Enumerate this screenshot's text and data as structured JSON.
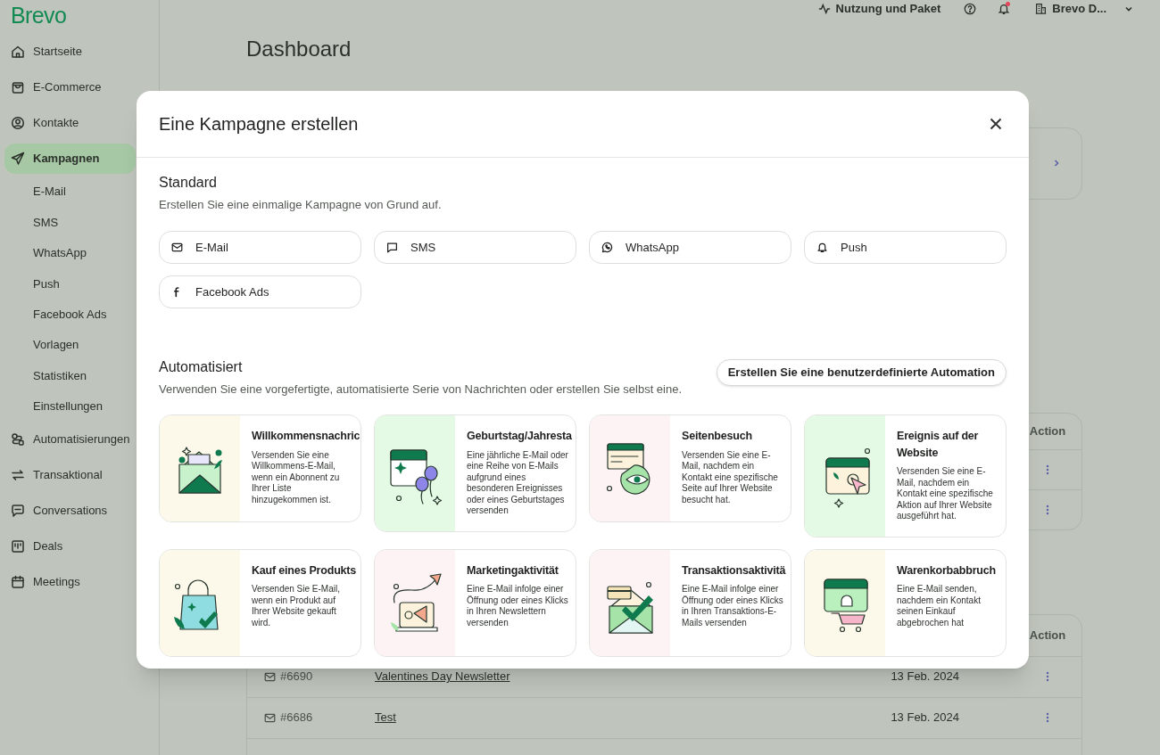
{
  "logo": "Brevo",
  "sidebar": {
    "items": [
      {
        "label": "Startseite",
        "kind": "home",
        "selected": false
      },
      {
        "label": "E-Commerce",
        "kind": "bag",
        "selected": false
      },
      {
        "label": "Kontakte",
        "kind": "contact",
        "selected": false
      },
      {
        "label": "Kampagnen",
        "kind": "send",
        "selected": true,
        "children": [
          {
            "label": "E-Mail",
            "selected": false
          },
          {
            "label": "SMS",
            "selected": false
          },
          {
            "label": "WhatsApp",
            "selected": false
          },
          {
            "label": "Push",
            "selected": false
          },
          {
            "label": "Facebook Ads",
            "selected": false
          },
          {
            "label": "Vorlagen",
            "selected": false
          },
          {
            "label": "Statistiken",
            "selected": false
          },
          {
            "label": "Einstellungen",
            "selected": false
          }
        ]
      },
      {
        "label": "Automatisierungen",
        "kind": "flow",
        "selected": false
      },
      {
        "label": "Transaktional",
        "kind": "swap",
        "selected": false
      },
      {
        "label": "Conversations",
        "kind": "chat",
        "selected": false
      },
      {
        "label": "Deals",
        "kind": "board",
        "selected": false
      },
      {
        "label": "Meetings",
        "kind": "calendar",
        "selected": false
      }
    ]
  },
  "topbar": {
    "usage": "Nutzung und Paket",
    "notifications": {
      "unread": true
    },
    "account": "Brevo D..."
  },
  "page": {
    "title": "Dashboard"
  },
  "activity_table": {
    "columns": [
      "Action"
    ]
  },
  "recent_table": {
    "columns": [
      "Action"
    ],
    "rows": [
      {
        "id": "#6690",
        "name": "Valentines Day Newsletter",
        "date": "13 Feb. 2024"
      },
      {
        "id": "#6686",
        "name": "Test",
        "date": "13 Feb. 2024"
      }
    ]
  },
  "modal": {
    "title": "Eine Kampagne erstellen",
    "standard": {
      "title": "Standard",
      "subtitle": "Erstellen Sie eine einmalige Kampagne von Grund auf.",
      "channels": [
        {
          "label": "E-Mail",
          "kind": "email"
        },
        {
          "label": "SMS",
          "kind": "sms"
        },
        {
          "label": "WhatsApp",
          "kind": "whatsapp"
        },
        {
          "label": "Push",
          "kind": "push"
        },
        {
          "label": "Facebook Ads",
          "kind": "facebook"
        }
      ]
    },
    "automated": {
      "title": "Automatisiert",
      "subtitle": "Verwenden Sie eine vorgefertigte, automatisierte Serie von Nachrichten oder erstellen Sie selbst eine.",
      "action": "Erstellen Sie eine benutzerdefinierte Automation",
      "templates": [
        {
          "title": "Willkommensnachric",
          "description": "Versenden Sie eine Willkommens-E-Mail, wenn ein Abonnent zu Ihrer Liste hinzugekommen ist."
        },
        {
          "title": "Geburtstag/Jahresta",
          "description": "Eine jährliche E-Mail oder eine Reihe von E-Mails aufgrund eines besonderen Ereignisses oder eines Geburtstages versenden"
        },
        {
          "title": "Seitenbesuch",
          "description": "Versenden Sie eine E-Mail, nachdem ein Kontakt eine spezifische Seite auf Ihrer Website besucht hat."
        },
        {
          "title": "Ereignis auf der Website",
          "description": "Versenden Sie eine E-Mail, nachdem ein Kontakt eine spezifische Aktion auf Ihrer Website ausgeführt hat."
        },
        {
          "title": "Kauf eines Produkts",
          "description": "Versenden Sie E-Mail, wenn ein Produkt auf Ihrer Website gekauft wird."
        },
        {
          "title": "Marketingaktivität",
          "description": "Eine E-Mail infolge einer Öffnung oder eines Klicks in Ihren Newslettern versenden"
        },
        {
          "title": "Transaktionsaktivitä",
          "description": "Eine E-Mail infolge einer Öffnung oder eines Klicks in Ihren Transaktions-E-Mails versenden"
        },
        {
          "title": "Warenkorbabbruch",
          "description": "Eine E-Mail senden, nachdem ein Kontakt seinen Einkauf abgebrochen hat"
        }
      ]
    }
  }
}
